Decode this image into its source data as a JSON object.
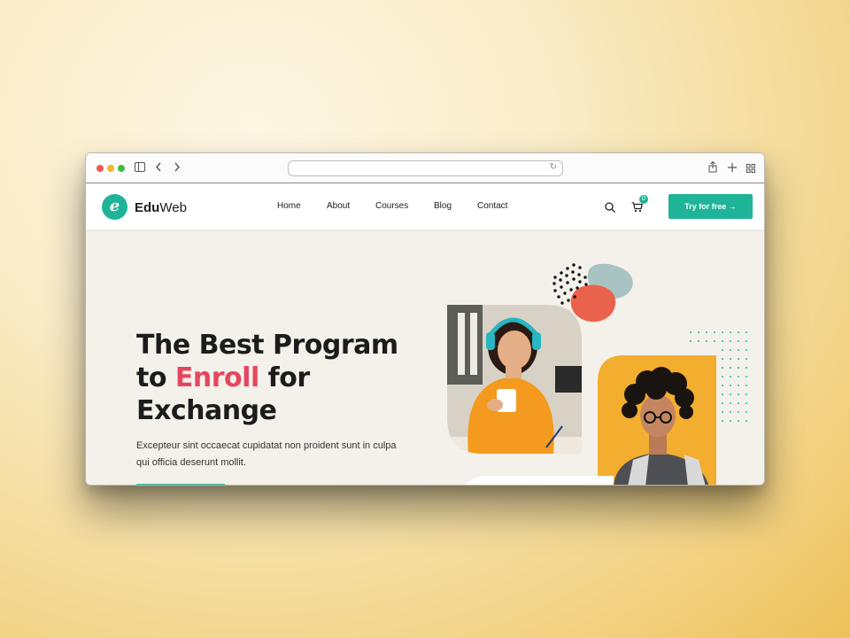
{
  "browser": {
    "traffic_lights": [
      "#ee5b52",
      "#f1b531",
      "#3dbd45"
    ],
    "url": ""
  },
  "nav": {
    "brand_bold": "Edu",
    "brand_light": "Web",
    "logo_letter": "e",
    "items": [
      "Home",
      "About",
      "Courses",
      "Blog",
      "Contact"
    ],
    "cart_count": "0",
    "cta_label": "Try for free →"
  },
  "hero": {
    "title_line1": "The Best Program",
    "title_to": "to ",
    "title_accent": "Enroll",
    "title_for": " for",
    "title_line3": "Exchange",
    "description": "Excepteur sint occaecat cupidatat non proident sunt in culpa qui officia deserunt mollit."
  },
  "colors": {
    "accent": "#1fb497",
    "highlight": "#e5465f",
    "hero_bg": "#f4f1ea",
    "photo_card_orange": "#f3ad2f"
  },
  "icons": [
    "sidebar-icon",
    "back-icon",
    "forward-icon",
    "reload-icon",
    "share-icon",
    "new-tab-icon",
    "tabs-grid-icon",
    "search-icon",
    "cart-icon",
    "arrow-right-icon"
  ]
}
